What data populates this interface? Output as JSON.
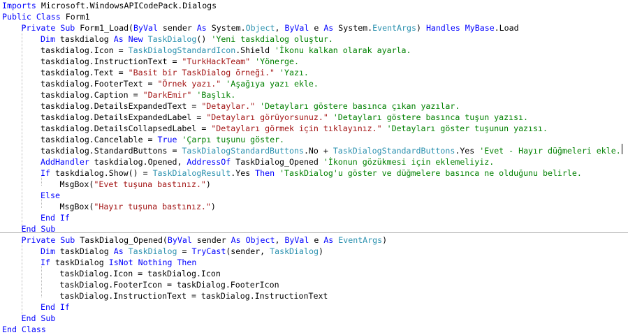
{
  "colors": {
    "background": "#ffffff",
    "keyword": "#0000ff",
    "string": "#a31515",
    "comment": "#008000",
    "type": "#2b91af",
    "plain": "#000000"
  },
  "lines": [
    {
      "indent": 0,
      "tokens": [
        [
          "kw",
          "Imports"
        ],
        [
          "txt",
          " Microsoft.WindowsAPICodePack.Dialogs"
        ]
      ]
    },
    {
      "indent": 0,
      "tokens": [
        [
          "kw",
          "Public Class"
        ],
        [
          "txt",
          " Form1"
        ]
      ]
    },
    {
      "indent": 1,
      "tokens": [
        [
          "kw",
          "Private Sub"
        ],
        [
          "txt",
          " Form1_Load("
        ],
        [
          "kw",
          "ByVal"
        ],
        [
          "txt",
          " sender "
        ],
        [
          "kw",
          "As"
        ],
        [
          "txt",
          " System."
        ],
        [
          "typ",
          "Object"
        ],
        [
          "txt",
          ", "
        ],
        [
          "kw",
          "ByVal"
        ],
        [
          "txt",
          " e "
        ],
        [
          "kw",
          "As"
        ],
        [
          "txt",
          " System."
        ],
        [
          "typ",
          "EventArgs"
        ],
        [
          "txt",
          ") "
        ],
        [
          "kw",
          "Handles"
        ],
        [
          "txt",
          " "
        ],
        [
          "kw",
          "MyBase"
        ],
        [
          "txt",
          ".Load"
        ]
      ]
    },
    {
      "indent": 2,
      "tokens": [
        [
          "kw",
          "Dim"
        ],
        [
          "txt",
          " taskdialog "
        ],
        [
          "kw",
          "As New"
        ],
        [
          "txt",
          " "
        ],
        [
          "typ",
          "TaskDialog"
        ],
        [
          "txt",
          "() "
        ],
        [
          "cmt",
          "'Yeni taskdialog oluştur."
        ]
      ]
    },
    {
      "indent": 2,
      "tokens": [
        [
          "txt",
          "taskdialog.Icon = "
        ],
        [
          "typ",
          "TaskDialogStandardIcon"
        ],
        [
          "txt",
          ".Shield "
        ],
        [
          "cmt",
          "'İkonu kalkan olarak ayarla."
        ]
      ]
    },
    {
      "indent": 2,
      "tokens": [
        [
          "txt",
          "taskdialog.InstructionText = "
        ],
        [
          "str",
          "\"TurkHackTeam\""
        ],
        [
          "txt",
          " "
        ],
        [
          "cmt",
          "'Yönerge."
        ]
      ]
    },
    {
      "indent": 2,
      "tokens": [
        [
          "txt",
          "taskdialog.Text = "
        ],
        [
          "str",
          "\"Basit bir TaskDialog örneği.\""
        ],
        [
          "txt",
          " "
        ],
        [
          "cmt",
          "'Yazı."
        ]
      ]
    },
    {
      "indent": 2,
      "tokens": [
        [
          "txt",
          "taskdialog.FooterText = "
        ],
        [
          "str",
          "\"Örnek yazı.\""
        ],
        [
          "txt",
          " "
        ],
        [
          "cmt",
          "'Aşağıya yazı ekle."
        ]
      ]
    },
    {
      "indent": 2,
      "tokens": [
        [
          "txt",
          "taskdialog.Caption = "
        ],
        [
          "str",
          "\"DarkEmir\""
        ],
        [
          "txt",
          " "
        ],
        [
          "cmt",
          "'Başlık."
        ]
      ]
    },
    {
      "indent": 2,
      "tokens": [
        [
          "txt",
          "taskdialog.DetailsExpandedText = "
        ],
        [
          "str",
          "\"Detaylar.\""
        ],
        [
          "txt",
          " "
        ],
        [
          "cmt",
          "'Detayları göstere basınca çıkan yazılar."
        ]
      ]
    },
    {
      "indent": 2,
      "tokens": [
        [
          "txt",
          "taskdialog.DetailsExpandedLabel = "
        ],
        [
          "str",
          "\"Detayları görüyorsunuz.\""
        ],
        [
          "txt",
          " "
        ],
        [
          "cmt",
          "'Detayları göstere basınca tuşun yazısı."
        ]
      ]
    },
    {
      "indent": 2,
      "tokens": [
        [
          "txt",
          "taskdialog.DetailsCollapsedLabel = "
        ],
        [
          "str",
          "\"Detayları görmek için tıklayınız.\""
        ],
        [
          "txt",
          " "
        ],
        [
          "cmt",
          "'Detayları göster tuşunun yazısı."
        ]
      ]
    },
    {
      "indent": 2,
      "tokens": [
        [
          "txt",
          "taskdialog.Cancelable = "
        ],
        [
          "kw",
          "True"
        ],
        [
          "txt",
          " "
        ],
        [
          "cmt",
          "'Çarpı tuşunu göster."
        ]
      ]
    },
    {
      "indent": 2,
      "tokens": [
        [
          "txt",
          "taskdialog.StandardButtons = "
        ],
        [
          "typ",
          "TaskDialogStandardButtons"
        ],
        [
          "txt",
          ".No + "
        ],
        [
          "typ",
          "TaskDialogStandardButtons"
        ],
        [
          "txt",
          ".Yes "
        ],
        [
          "cmt",
          "'Evet - Hayır düğmeleri ekle."
        ]
      ]
    },
    {
      "indent": 2,
      "tokens": [
        [
          "kw",
          "AddHandler"
        ],
        [
          "txt",
          " taskdialog.Opened, "
        ],
        [
          "kw",
          "AddressOf"
        ],
        [
          "txt",
          " TaskDialog_Opened "
        ],
        [
          "cmt",
          "'İkonun gözükmesi için eklemeliyiz."
        ]
      ]
    },
    {
      "indent": 2,
      "tokens": [
        [
          "kw",
          "If"
        ],
        [
          "txt",
          " taskdialog.Show() = "
        ],
        [
          "typ",
          "TaskDialogResult"
        ],
        [
          "txt",
          ".Yes "
        ],
        [
          "kw",
          "Then"
        ],
        [
          "txt",
          " "
        ],
        [
          "cmt",
          "'TaskDialog'u göster ve düğmelere basınca ne olduğunu belirle."
        ]
      ]
    },
    {
      "indent": 3,
      "tokens": [
        [
          "txt",
          "MsgBox("
        ],
        [
          "str",
          "\"Evet tuşuna bastınız.\""
        ],
        [
          "txt",
          ")"
        ]
      ]
    },
    {
      "indent": 2,
      "tokens": [
        [
          "kw",
          "Else"
        ]
      ]
    },
    {
      "indent": 3,
      "tokens": [
        [
          "txt",
          "MsgBox("
        ],
        [
          "str",
          "\"Hayır tuşuna bastınız.\""
        ],
        [
          "txt",
          ")"
        ]
      ]
    },
    {
      "indent": 2,
      "tokens": [
        [
          "kw",
          "End If"
        ]
      ]
    },
    {
      "indent": 1,
      "tokens": [
        [
          "kw",
          "End Sub"
        ]
      ]
    },
    {
      "indent": 1,
      "tokens": [
        [
          "kw",
          "Private Sub"
        ],
        [
          "txt",
          " TaskDialog_Opened("
        ],
        [
          "kw",
          "ByVal"
        ],
        [
          "txt",
          " sender "
        ],
        [
          "kw",
          "As Object"
        ],
        [
          "txt",
          ", "
        ],
        [
          "kw",
          "ByVal"
        ],
        [
          "txt",
          " e "
        ],
        [
          "kw",
          "As"
        ],
        [
          "txt",
          " "
        ],
        [
          "typ",
          "EventArgs"
        ],
        [
          "txt",
          ")"
        ]
      ]
    },
    {
      "indent": 2,
      "tokens": [
        [
          "kw",
          "Dim"
        ],
        [
          "txt",
          " taskDialog "
        ],
        [
          "kw",
          "As"
        ],
        [
          "txt",
          " "
        ],
        [
          "typ",
          "TaskDialog"
        ],
        [
          "txt",
          " = "
        ],
        [
          "kw",
          "TryCast"
        ],
        [
          "txt",
          "(sender, "
        ],
        [
          "typ",
          "TaskDialog"
        ],
        [
          "txt",
          ")"
        ]
      ]
    },
    {
      "indent": 2,
      "tokens": [
        [
          "kw",
          "If"
        ],
        [
          "txt",
          " taskDialog "
        ],
        [
          "kw",
          "IsNot Nothing Then"
        ]
      ]
    },
    {
      "indent": 3,
      "tokens": [
        [
          "txt",
          "taskDialog.Icon = taskDialog.Icon"
        ]
      ]
    },
    {
      "indent": 3,
      "tokens": [
        [
          "txt",
          "taskDialog.FooterIcon = taskDialog.FooterIcon"
        ]
      ]
    },
    {
      "indent": 3,
      "tokens": [
        [
          "txt",
          "taskDialog.InstructionText = taskDialog.InstructionText"
        ]
      ]
    },
    {
      "indent": 2,
      "tokens": [
        [
          "kw",
          "End If"
        ]
      ]
    },
    {
      "indent": 1,
      "tokens": [
        [
          "kw",
          "End Sub"
        ]
      ]
    },
    {
      "indent": 0,
      "tokens": [
        [
          "kw",
          "End Class"
        ]
      ]
    }
  ]
}
